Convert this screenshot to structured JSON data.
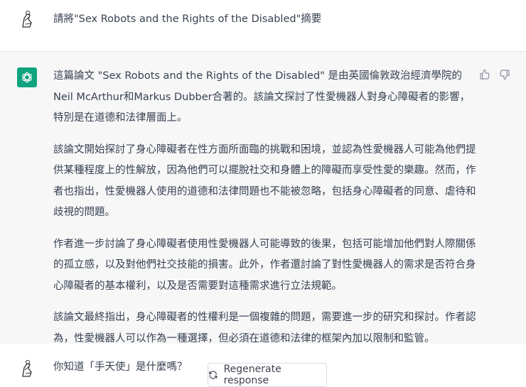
{
  "conversation": {
    "user_message_1": "請將\"Sex Robots and the Rights of the Disabled\"摘要",
    "assistant_response": {
      "paragraphs": [
        "這篇論文 \"Sex Robots and the Rights of the Disabled\" 是由英國倫敦政治經濟學院的Neil McArthur和Markus Dubber合著的。該論文探討了性愛機器人對身心障礙者的影響，特別是在道德和法律層面上。",
        "該論文開始探討了身心障礙者在性方面所面臨的挑戰和困境，並認為性愛機器人可能為他們提供某種程度上的性解放，因為他們可以擺脫社交和身體上的障礙而享受性愛的樂趣。然而，作者也指出，性愛機器人使用的道德和法律問題也不能被忽略，包括身心障礙者的同意、虐待和歧視的問題。",
        "作者進一步討論了身心障礙者使用性愛機器人可能導致的後果，包括可能增加他們對人際關係的孤立感，以及對他們社交技能的損害。此外，作者還討論了對性愛機器人的需求是否符合身心障礙者的基本權利，以及是否需要對這種需求進行立法規範。",
        "該論文最終指出，身心障礙者的性權利是一個複雜的問題，需要進一步的研究和探討。作者認為，性愛機器人可以作為一種選擇，但必須在道德和法律的框架內加以限制和監管。"
      ]
    },
    "user_message_2": "你知道「手天使」是什麼嗎？"
  },
  "regenerate_button": {
    "label": "Regenerate response"
  },
  "icons": {
    "user_avatar": "user-avatar-sketch",
    "assistant_avatar": "openai-logo-icon",
    "thumbs_up": "thumbs-up-icon",
    "thumbs_down": "thumbs-down-icon",
    "regenerate": "refresh-icon"
  },
  "colors": {
    "assistant_avatar_bg": "#10a37f",
    "assistant_row_bg": "#f7f7f8"
  }
}
